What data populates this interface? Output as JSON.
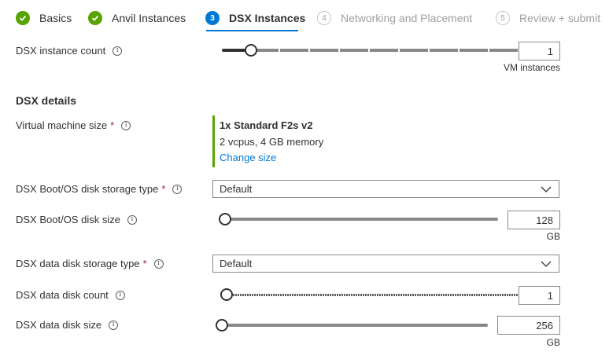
{
  "wizard": {
    "steps": [
      {
        "label": "Basics",
        "state": "done"
      },
      {
        "label": "Anvil Instances",
        "state": "done"
      },
      {
        "label": "DSX Instances",
        "state": "active",
        "number": "3"
      },
      {
        "label": "Networking and Placement",
        "state": "pending",
        "number": "4"
      },
      {
        "label": "Review + submit",
        "state": "pending",
        "number": "5"
      }
    ]
  },
  "colors": {
    "accent": "#0078d4",
    "success": "#57a300",
    "required": "#a4262c"
  },
  "instance_count": {
    "label": "DSX instance count",
    "value": "1",
    "unit": "VM instances",
    "slider_fraction": 0.1
  },
  "details": {
    "heading": "DSX details",
    "vm_size": {
      "label": "Virtual machine size",
      "required": "*",
      "name": "1x Standard F2s v2",
      "spec": "2 vcpus, 4 GB memory",
      "change_link": "Change size"
    },
    "boot_disk_type": {
      "label": "DSX Boot/OS disk storage type",
      "required": "*",
      "value": "Default"
    },
    "boot_disk_size": {
      "label": "DSX Boot/OS disk size",
      "value": "128",
      "unit": "GB",
      "slider_fraction": 0
    },
    "data_disk_type": {
      "label": "DSX data disk storage type",
      "required": "*",
      "value": "Default"
    },
    "data_disk_count": {
      "label": "DSX data disk count",
      "value": "1",
      "slider_fraction": 0
    },
    "data_disk_size": {
      "label": "DSX data disk size",
      "value": "256",
      "unit": "GB",
      "slider_fraction": 0
    }
  },
  "icons": {
    "info": "info-icon",
    "check": "checkmark-icon",
    "chevron": "chevron-down-icon"
  }
}
